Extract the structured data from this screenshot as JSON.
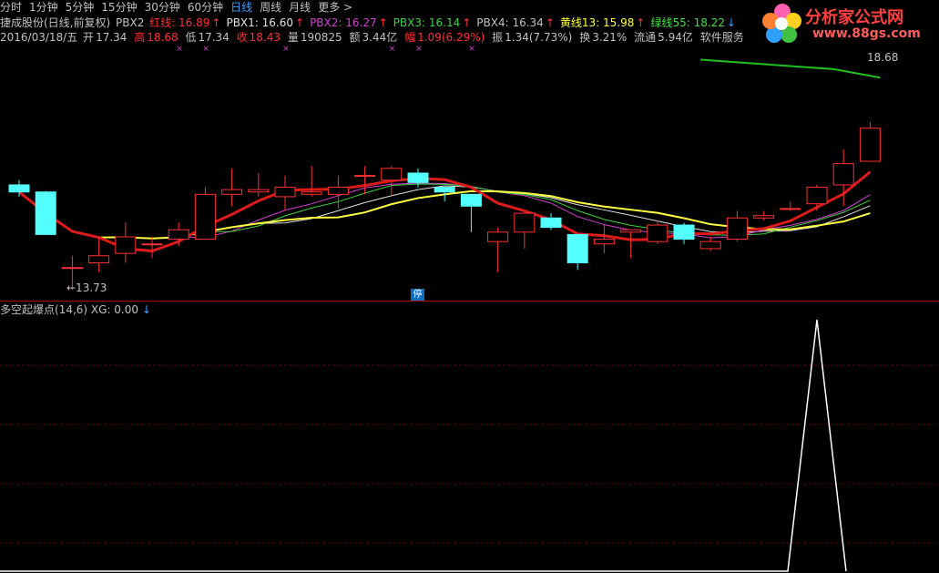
{
  "toolbar": {
    "periods": [
      "分时",
      "1分钟",
      "5分钟",
      "15分钟",
      "30分钟",
      "60分钟",
      "日线",
      "周线",
      "月线",
      "更多 >"
    ],
    "active_index": 6
  },
  "header": {
    "stock_title": "捷成股份(日线,前复权)",
    "indicator_name": "PBX2",
    "indicators": [
      {
        "label": "红线: 16.89",
        "arrow": "↑",
        "color": "#ff3030"
      },
      {
        "label": "PBX1: 16.60",
        "arrow": "↑",
        "color": "#e0e0e0"
      },
      {
        "label": "PBX2: 16.27",
        "arrow": "↑",
        "color": "#d040d0"
      },
      {
        "label": "PBX3: 16.14",
        "arrow": "↑",
        "color": "#40d040"
      },
      {
        "label": "PBX4: 16.34",
        "arrow": "↑",
        "color": "#c0c0c0"
      },
      {
        "label": "黄线13: 15.98",
        "arrow": "↑",
        "color": "#ffff40"
      },
      {
        "label": "绿线55: 18.22",
        "arrow": "↓",
        "color": "#40e040"
      }
    ]
  },
  "quote": {
    "date": "2016/03/18/五",
    "open_label": "开",
    "open": "17.34",
    "high_label": "高",
    "high": "18.68",
    "low_label": "低",
    "low": "17.34",
    "close_label": "收",
    "close": "18.43",
    "volume_label": "量",
    "volume": "190825",
    "amount_label": "额",
    "amount": "3.44亿",
    "change_label": "幅",
    "change": "1.09(6.29%)",
    "amplitude_label": "振",
    "amplitude": "1.34(7.73%)",
    "turnover_label": "换",
    "turnover": "3.21%",
    "float_label": "流通",
    "float": "5.94亿",
    "industry": "软件服务"
  },
  "chart_labels": {
    "low_marker": "←13.73",
    "high_marker": "18.68",
    "stop_badge": "停"
  },
  "sub_indicator": {
    "name": "多空起爆点(14,6)",
    "value_label": "XG: 0.00",
    "arrow": "↓"
  },
  "logo": {
    "title": "分析家公式网",
    "url": "www.88gs.com"
  },
  "colors": {
    "up": "#ff3030",
    "down": "#54ffff",
    "background": "#000000",
    "red_line": "#dd1a1a",
    "yellow_line": "#ffff40",
    "green_line": "#20c020"
  },
  "chart_data": {
    "type": "candlestick",
    "candles": [
      {
        "o": 15.95,
        "c": 15.8,
        "h": 16.05,
        "l": 15.7
      },
      {
        "o": 15.8,
        "c": 14.9,
        "h": 15.82,
        "l": 14.9
      },
      {
        "o": 14.2,
        "c": 14.2,
        "h": 14.45,
        "l": 13.73
      },
      {
        "o": 14.3,
        "c": 14.45,
        "h": 14.85,
        "l": 14.1
      },
      {
        "o": 14.5,
        "c": 14.85,
        "h": 15.15,
        "l": 14.3
      },
      {
        "o": 14.7,
        "c": 14.7,
        "h": 14.85,
        "l": 14.4
      },
      {
        "o": 14.8,
        "c": 15.0,
        "h": 15.15,
        "l": 14.65
      },
      {
        "o": 14.8,
        "c": 15.75,
        "h": 15.9,
        "l": 14.8
      },
      {
        "o": 15.75,
        "c": 15.85,
        "h": 16.3,
        "l": 15.5
      },
      {
        "o": 15.8,
        "c": 15.85,
        "h": 16.2,
        "l": 15.7
      },
      {
        "o": 15.7,
        "c": 15.9,
        "h": 16.15,
        "l": 15.4
      },
      {
        "o": 15.75,
        "c": 15.8,
        "h": 16.35,
        "l": 15.7
      },
      {
        "o": 15.75,
        "c": 15.9,
        "h": 16.15,
        "l": 15.45
      },
      {
        "o": 16.15,
        "c": 16.15,
        "h": 16.35,
        "l": 15.75
      },
      {
        "o": 16.05,
        "c": 16.3,
        "h": 16.35,
        "l": 15.7
      },
      {
        "o": 16.2,
        "c": 16.0,
        "h": 16.3,
        "l": 15.9
      },
      {
        "o": 15.9,
        "c": 15.8,
        "h": 15.9,
        "l": 15.6
      },
      {
        "o": 15.75,
        "c": 15.5,
        "h": 15.75,
        "l": 14.95
      },
      {
        "o": 14.75,
        "c": 14.95,
        "h": 15.05,
        "l": 14.1
      },
      {
        "o": 14.95,
        "c": 15.35,
        "h": 15.35,
        "l": 14.6
      },
      {
        "o": 15.25,
        "c": 15.05,
        "h": 15.35,
        "l": 15.0
      },
      {
        "o": 14.9,
        "c": 14.3,
        "h": 14.9,
        "l": 14.15
      },
      {
        "o": 14.7,
        "c": 14.8,
        "h": 15.1,
        "l": 14.5
      },
      {
        "o": 14.95,
        "c": 15.0,
        "h": 15.0,
        "l": 14.4
      },
      {
        "o": 14.75,
        "c": 15.1,
        "h": 15.2,
        "l": 14.7
      },
      {
        "o": 15.1,
        "c": 14.8,
        "h": 15.15,
        "l": 14.7
      },
      {
        "o": 14.6,
        "c": 14.75,
        "h": 14.85,
        "l": 14.55
      },
      {
        "o": 14.8,
        "c": 15.25,
        "h": 15.4,
        "l": 14.75
      },
      {
        "o": 15.25,
        "c": 15.3,
        "h": 15.4,
        "l": 15.2
      },
      {
        "o": 15.45,
        "c": 15.45,
        "h": 15.6,
        "l": 15.4
      },
      {
        "o": 15.55,
        "c": 15.9,
        "h": 15.95,
        "l": 15.4
      },
      {
        "o": 15.95,
        "c": 16.4,
        "h": 16.7,
        "l": 15.5
      },
      {
        "o": 16.45,
        "c": 17.15,
        "h": 17.28,
        "l": 16.45
      }
    ],
    "stop_marks_x": [
      6,
      7,
      10,
      14,
      15,
      17
    ],
    "low_value": 13.73,
    "high_value": 18.68,
    "sub_series": {
      "name": "XG",
      "signal_index": 30,
      "signal_value": 1
    }
  }
}
